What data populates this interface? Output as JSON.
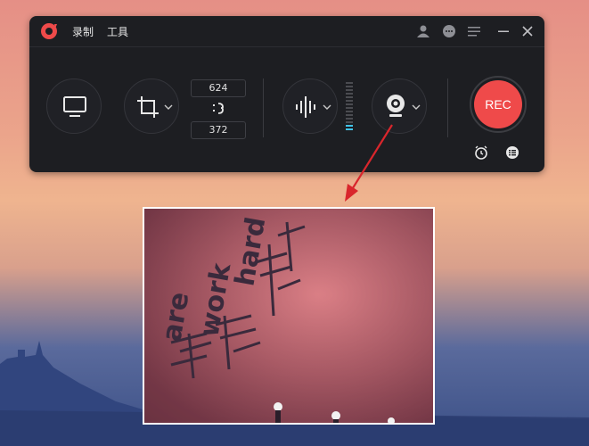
{
  "menu": {
    "record": "录制",
    "tools": "工具"
  },
  "size": {
    "width": "624",
    "height": "372"
  },
  "rec_label": "REC",
  "webcam_text": {
    "line1": "are",
    "line2": "work",
    "line3": "hard"
  },
  "colors": {
    "accent": "#ef4a4a",
    "panel": "#1d1e22",
    "arrow": "#d9262c"
  },
  "icons": {
    "logo": "record-logo-icon",
    "account": "account-icon",
    "chat": "chat-icon",
    "menu": "hamburger-icon",
    "minimize": "minimize-icon",
    "close": "close-icon",
    "screen": "monitor-icon",
    "crop": "crop-icon",
    "lock": "lock-ratio-icon",
    "audio": "audio-wave-icon",
    "webcam": "webcam-icon",
    "schedule": "alarm-clock-icon",
    "list": "task-list-icon"
  }
}
